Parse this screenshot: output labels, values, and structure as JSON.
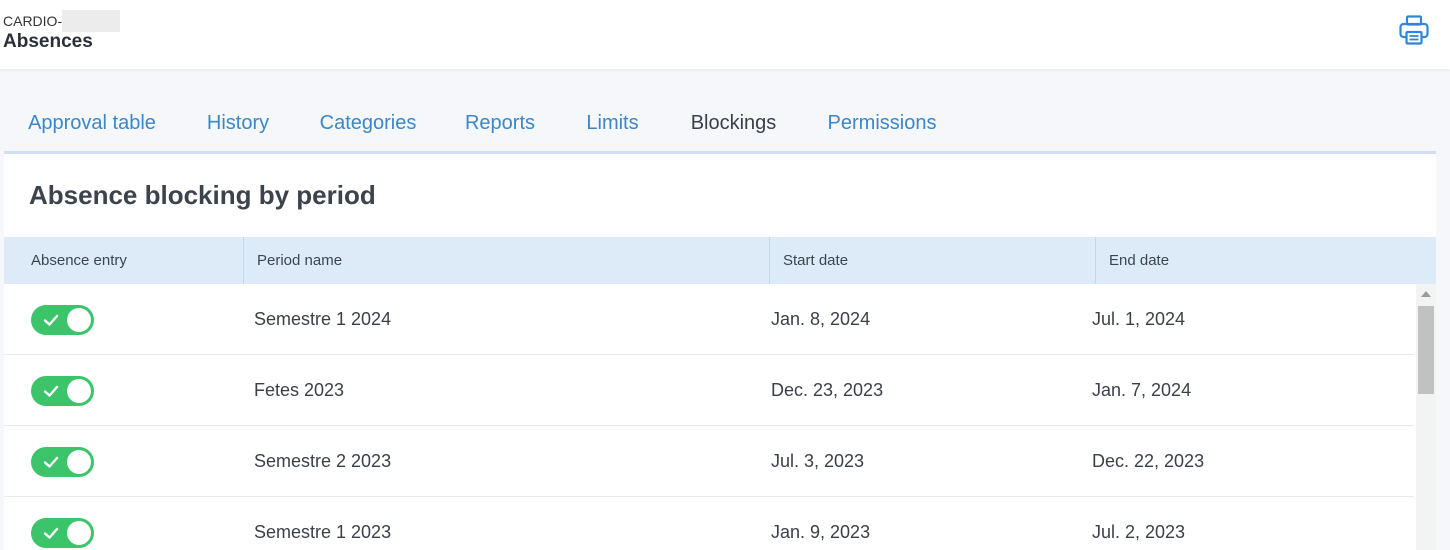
{
  "header": {
    "org_name": "CARDIO-",
    "app_title": "Absences",
    "print_icon": "printer-icon"
  },
  "tabs": [
    {
      "label": "Approval table",
      "active": false
    },
    {
      "label": "History",
      "active": false
    },
    {
      "label": "Categories",
      "active": false
    },
    {
      "label": "Reports",
      "active": false
    },
    {
      "label": "Limits",
      "active": false
    },
    {
      "label": "Blockings",
      "active": true
    },
    {
      "label": "Permissions",
      "active": false
    }
  ],
  "section": {
    "title": "Absence blocking by period"
  },
  "table": {
    "columns": [
      "Absence entry",
      "Period name",
      "Start date",
      "End date"
    ],
    "rows": [
      {
        "enabled": true,
        "period": "Semestre 1 2024",
        "start": "Jan. 8, 2024",
        "end": "Jul. 1, 2024"
      },
      {
        "enabled": true,
        "period": "Fetes 2023",
        "start": "Dec. 23, 2023",
        "end": "Jan. 7, 2024"
      },
      {
        "enabled": true,
        "period": "Semestre 2 2023",
        "start": "Jul. 3, 2023",
        "end": "Dec. 22, 2023"
      },
      {
        "enabled": true,
        "period": "Semestre 1 2023",
        "start": "Jan. 9, 2023",
        "end": "Jul. 2, 2023"
      }
    ]
  },
  "colors": {
    "accent": "#3a87c9",
    "toggle_on": "#3cc46a",
    "header_bg": "#ddebf8"
  }
}
